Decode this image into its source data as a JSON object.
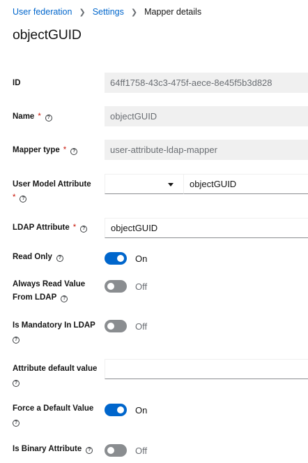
{
  "breadcrumb": {
    "items": [
      "User federation",
      "Settings"
    ],
    "current": "Mapper details"
  },
  "title": "objectGUID",
  "fields": {
    "id": {
      "label": "ID",
      "value": "64ff1758-43c3-475f-aece-8e45f5b3d828"
    },
    "name": {
      "label": "Name",
      "value": "objectGUID"
    },
    "mapper_type": {
      "label": "Mapper type",
      "value": "user-attribute-ldap-mapper"
    },
    "user_model_attribute": {
      "label": "User Model Attribute",
      "select_value": "",
      "value": "objectGUID"
    },
    "ldap_attribute": {
      "label": "LDAP Attribute",
      "value": "objectGUID"
    },
    "read_only": {
      "label": "Read Only",
      "state": "On"
    },
    "always_read": {
      "label_line1": "Always Read Value",
      "label_line2": "From LDAP",
      "state": "Off"
    },
    "mandatory": {
      "label": "Is Mandatory In LDAP",
      "state": "Off"
    },
    "default_value": {
      "label": "Attribute default value",
      "value": ""
    },
    "force_default": {
      "label": "Force a Default Value",
      "state": "On"
    },
    "binary": {
      "label": "Is Binary Attribute",
      "state": "Off"
    }
  },
  "required_mark": "*",
  "help_glyph": "?",
  "colors": {
    "link": "#0066cc",
    "toggle_on": "#0066cc",
    "toggle_off": "#8a8d90",
    "required": "#c9190b"
  }
}
